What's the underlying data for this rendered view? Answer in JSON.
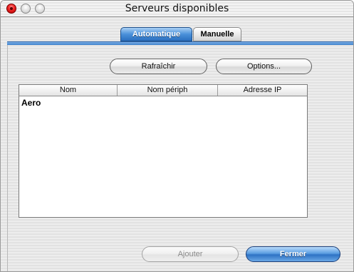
{
  "window": {
    "title": "Serveurs disponibles"
  },
  "tabs": [
    {
      "label": "Automatique",
      "active": true
    },
    {
      "label": "Manuelle",
      "active": false
    }
  ],
  "toolbar": {
    "refresh_label": "Rafraîchir",
    "options_label": "Options..."
  },
  "table": {
    "columns": [
      "Nom",
      "Nom périph",
      "Adresse IP"
    ],
    "rows": [
      {
        "name": "Aero",
        "device": "",
        "ip": ""
      }
    ]
  },
  "footer": {
    "add_label": "Ajouter",
    "add_enabled": false,
    "close_label": "Fermer"
  },
  "colors": {
    "accent": "#3a7fcb",
    "close_light": "#e22222"
  }
}
